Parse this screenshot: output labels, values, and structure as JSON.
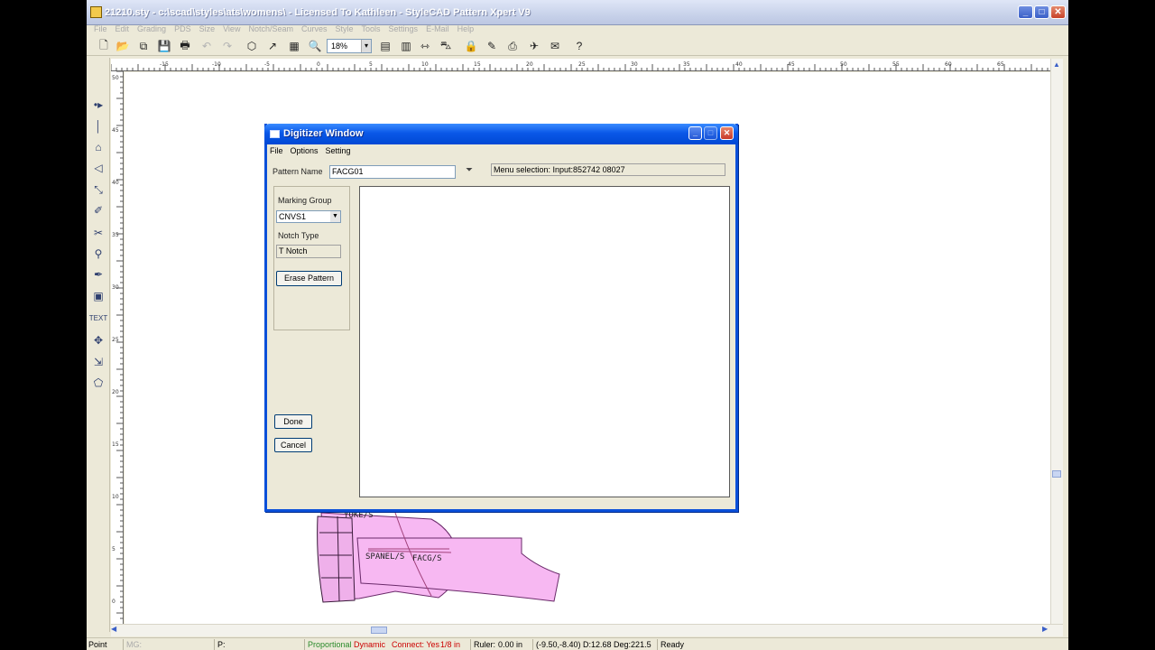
{
  "window": {
    "title": "21210.sty - c:\\scad\\styles\\ats\\womens\\ - Licensed To Kathleen - StyleCAD Pattern Xpert V9",
    "minimize": "_",
    "maximize": "□",
    "close": "✕"
  },
  "menubar": [
    "File",
    "Edit",
    "Grading",
    "PDS",
    "Size",
    "View",
    "Notch/Seam",
    "Curves",
    "Style",
    "Tools",
    "Settings",
    "E-Mail",
    "Help"
  ],
  "toolbar": {
    "zoom_value": "18%",
    "zoom_arrow": "▾"
  },
  "icons": {
    "new": "🗋",
    "open": "📂",
    "print": "🖶",
    "save": "💾",
    "undo": "↶",
    "redo": "↷",
    "cut": "✂",
    "select": "↗",
    "grid": "▦",
    "zoom": "🔍"
  },
  "ruler": {
    "top_ticks": [
      "-15",
      "-10",
      "-5",
      "0",
      "5",
      "10",
      "15",
      "20",
      "25",
      "30",
      "35",
      "40",
      "45",
      "50",
      "55",
      "60",
      "65"
    ],
    "left_ticks": [
      "50",
      "45",
      "40",
      "35",
      "30",
      "25",
      "20",
      "15",
      "10",
      "5",
      "0"
    ]
  },
  "pattern_labels": [
    "YOKE/S",
    "SPANEL/S",
    "FACG/S"
  ],
  "dialog": {
    "title": "Digitizer Window",
    "menu": [
      "File",
      "Options",
      "Setting"
    ],
    "pattern_name_label": "Pattern Name",
    "pattern_name_value": "FACG01",
    "status_text": "Menu selection:  Input:852742 08027",
    "marking_group_label": "Marking Group",
    "marking_group_value": "CNVS1",
    "notch_type_label": "Notch Type",
    "notch_type_value": "T Notch",
    "erase_label": "Erase Pattern",
    "done_label": "Done",
    "cancel_label": "Cancel"
  },
  "statusbar": {
    "mode": "Point",
    "mg": "MG:",
    "p": "P:",
    "proportional": "Proportional",
    "dynamic": "Dynamic",
    "connect": "Connect: Yes",
    "fraction": "1/8 in",
    "ruler_label": "Ruler:",
    "ruler_value": "0.00 in",
    "coords": "(-9.50,-8.40) D:12.68 Deg:221.5",
    "state": "Ready"
  },
  "colors": {
    "pattern_fill": "#f7b8f2",
    "dialog_border": "#0a4fd9",
    "status_red": "#cc0000",
    "status_green": "#2a8a2a"
  }
}
